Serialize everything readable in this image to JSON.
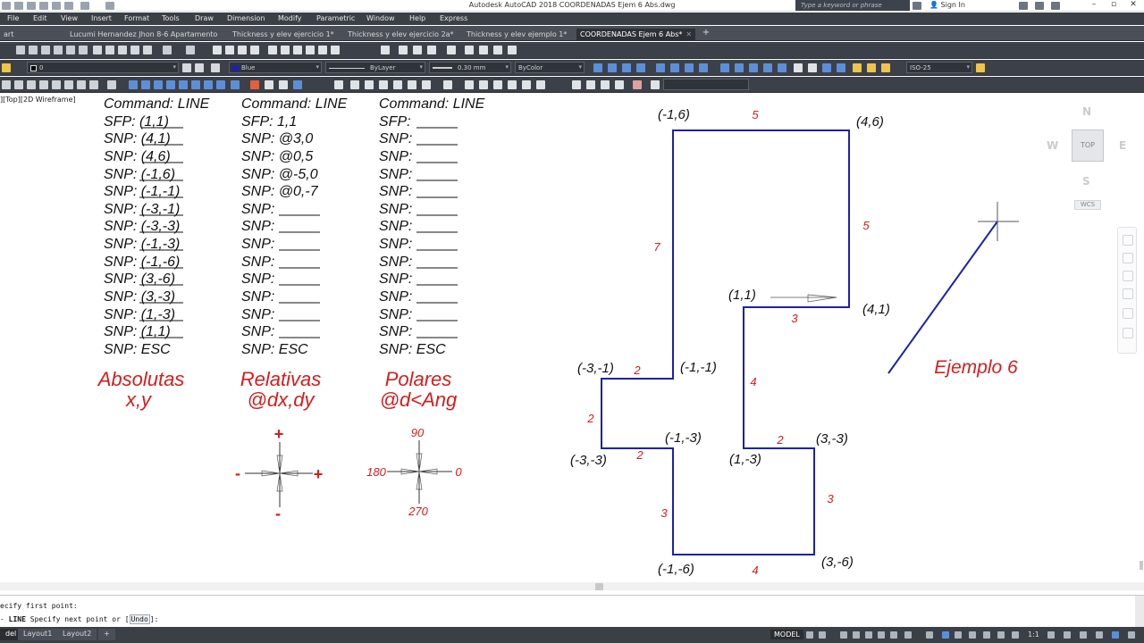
{
  "titlebar": {
    "title": "Autodesk AutoCAD 2018    COORDENADAS Ejem 6 Abs.dwg",
    "search_placeholder": "Type a keyword or phrase",
    "sign_in": "Sign In"
  },
  "menu": [
    {
      "label": "File"
    },
    {
      "label": "Edit"
    },
    {
      "label": "View"
    },
    {
      "label": "Insert"
    },
    {
      "label": "Format"
    },
    {
      "label": "Tools"
    },
    {
      "label": "Draw"
    },
    {
      "label": "Dimension"
    },
    {
      "label": "Modify"
    },
    {
      "label": "Parametric"
    },
    {
      "label": "Window"
    },
    {
      "label": "Help"
    },
    {
      "label": "Express"
    }
  ],
  "tabs": [
    {
      "label": "art"
    },
    {
      "label": "Lucumi Hernandez Jhon 8-6 Apartamento"
    },
    {
      "label": "Thickness y elev ejercicio 1*"
    },
    {
      "label": "Thickness y elev ejercicio 2a*"
    },
    {
      "label": "Thickness y elev ejemplo 1*"
    },
    {
      "label": "COORDENADAS Ejem 6 Abs*"
    }
  ],
  "toolbar": {
    "layer_value": "0",
    "color_value": "Blue",
    "linetype_value": "ByLayer",
    "lineweight_value": "0.30 mm",
    "plotstyle_value": "ByColor",
    "dimstyle_value": "ISO-25"
  },
  "viewport_label": "][Top][2D Wireframe]",
  "columns": {
    "abs": {
      "lines": [
        "Command: LINE",
        "SFP: (1,1)",
        "SNP: (4,1)",
        "SNP: (4,6)",
        "SNP: (-1,6)",
        "SNP: (-1,-1)",
        "SNP: (-3,-1)",
        "SNP: (-3,-3)",
        "SNP: (-1,-3)",
        "SNP: (-1,-6)",
        "SNP: (3,-6)",
        "SNP: (3,-3)",
        "SNP: (1,-3)",
        "SNP: (1,1)",
        "SNP: ESC"
      ],
      "heading": "Absolutas",
      "formula": "x,y"
    },
    "rel": {
      "lines": [
        "Command: LINE",
        "SFP: 1,1",
        "SNP: @3,0",
        "SNP: @0,5",
        "SNP: @-5,0",
        "SNP: @0,-7",
        "SNP:",
        "SNP:",
        "SNP:",
        "SNP:",
        "SNP:",
        "SNP:",
        "SNP:",
        "SNP:",
        "SNP: ESC"
      ],
      "heading": "Relativas",
      "formula": "@dx,dy"
    },
    "pol": {
      "lines": [
        "Command: LINE",
        "SFP:",
        "SNP:",
        "SNP:",
        "SNP:",
        "SNP:",
        "SNP:",
        "SNP:",
        "SNP:",
        "SNP:",
        "SNP:",
        "SNP:",
        "SNP:",
        "SNP:",
        "SNP: ESC"
      ],
      "heading": "Polares",
      "formula": "@d<Ang"
    }
  },
  "axes": {
    "rel": {
      "plus_y": "+",
      "minus_y": "-",
      "minus_x": "-",
      "plus_x": "+"
    },
    "pol": {
      "a90": "90",
      "a180": "180",
      "a0": "0",
      "a270": "270"
    }
  },
  "points": {
    "p_m1_6": "(-1,6)",
    "p_4_6": "(4,6)",
    "p_1_1": "(1,1)",
    "p_4_1": "(4,1)",
    "p_m3_m1": "(-3,-1)",
    "p_m1_m1": "(-1,-1)",
    "p_m1_m3": "(-1,-3)",
    "p_3_m3": "(3,-3)",
    "p_m3_m3": "(-3,-3)",
    "p_1_m3": "(1,-3)",
    "p_m1_m6": "(-1,-6)",
    "p_3_m6": "(3,-6)"
  },
  "segments": {
    "top": "5",
    "right_upper": "5",
    "left_upper": "7",
    "inner_top": "3",
    "inner_vert": "4",
    "step_top": "2",
    "step_left": "2",
    "step_bottom": "2",
    "inner_bottom": "2",
    "right_lower": "3",
    "left_lower": "3",
    "bottom": "4"
  },
  "example_label": "Ejemplo 6",
  "viewcube": {
    "n": "N",
    "s": "S",
    "e": "E",
    "w": "W",
    "top": "TOP",
    "wcs": "WCS"
  },
  "command_line": {
    "history": "ecify first point:",
    "prompt_cmd": "LINE",
    "prompt_text": "Specify next point or [",
    "undo": "Undo",
    "prompt_end": "]:"
  },
  "status": {
    "tabs": [
      "del",
      "Layout1",
      "Layout2"
    ],
    "model": "MODEL",
    "scale": "1:1"
  },
  "colors": {
    "drawing_line": "#1f1fae",
    "annotation_red": "#d51d1d",
    "ui_dark": "#3b4047"
  }
}
